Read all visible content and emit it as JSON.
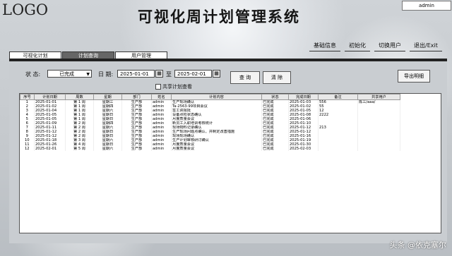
{
  "app": {
    "logo": "LOGO",
    "title": "可视化周计划管理系统",
    "user": "admin"
  },
  "topmenu": [
    "基础信息",
    "初始化",
    "切换用户",
    "退出/Exit"
  ],
  "tabs": [
    {
      "label": "可视化计划",
      "active": false
    },
    {
      "label": "计划查询",
      "active": true
    },
    {
      "label": "用户管理",
      "active": false
    }
  ],
  "filters": {
    "status_label": "状 态:",
    "status_value": "已完成",
    "date_label": "日 期:",
    "date_from": "2025-01-01",
    "to_label": "至",
    "date_to": "2025-02-01",
    "query_button": "查 询",
    "clear_button": "清 除",
    "export_button": "导出明细",
    "shared_checkbox": "共享计划查看"
  },
  "table": {
    "columns": [
      "序号",
      "计划日期",
      "周数",
      "星期",
      "部门",
      "姓名",
      "计划内容",
      "状态",
      "完成日期",
      "备注",
      "共享用户"
    ],
    "rows": [
      [
        "1",
        "2025-01-01",
        "第 1 周",
        "星期三",
        "生产部",
        "admin",
        "生产现场确认",
        "已完成",
        "2025-01-03",
        "556",
        "陈三/aaa/"
      ],
      [
        "2",
        "2025-01-02",
        "第 1 周",
        "星期四",
        "生产部",
        "admin",
        "Ta-2563-99项目会议",
        "已完成",
        "2025-01-02",
        "55",
        ""
      ],
      [
        "3",
        "2025-01-04",
        "第 1 周",
        "星期六",
        "生产部",
        "admin",
        "签工资报批",
        "已完成",
        "2025-01-05",
        "12",
        ""
      ],
      [
        "4",
        "2025-01-05",
        "第 1 周",
        "星期日",
        "生产部",
        "admin",
        "设备点检状态确认",
        "已完成",
        "2025-01-08",
        "2222",
        ""
      ],
      [
        "5",
        "2025-01-05",
        "第 1 周",
        "星期日",
        "生产部",
        "admin",
        "月度质量会议",
        "已完成",
        "2025-01-06",
        "",
        ""
      ],
      [
        "6",
        "2025-01-09",
        "第 2 周",
        "星期四",
        "生产部",
        "admin",
        "新员工入职培训考核统计",
        "已完成",
        "2025-01-10",
        "",
        ""
      ],
      [
        "7",
        "2025-01-11",
        "第 2 周",
        "星期六",
        "生产部",
        "admin",
        "现场物料记录确认",
        "已完成",
        "2025-01-12",
        "213",
        ""
      ],
      [
        "8",
        "2025-01-12",
        "第 2 周",
        "星期日",
        "生产部",
        "admin",
        "生产现场问题点确认、并制定改善措施",
        "已完成",
        "2025-01-12",
        "",
        ""
      ],
      [
        "9",
        "2025-01-12",
        "第 2 周",
        "星期日",
        "生产部",
        "admin",
        "现场现场确认",
        "已完成",
        "2025-01-16",
        "",
        ""
      ],
      [
        "10",
        "2025-01-18",
        "第 3 周",
        "星期六",
        "生产部",
        "admin",
        "生产计划审核研讨确认",
        "已完成",
        "2025-01-19",
        "",
        ""
      ],
      [
        "11",
        "2025-01-26",
        "第 4 周",
        "星期日",
        "生产部",
        "admin",
        "月度质量会议",
        "已完成",
        "2025-01-30",
        "",
        ""
      ],
      [
        "12",
        "2025-02-01",
        "第 5 周",
        "星期六",
        "生产部",
        "admin",
        "月度质量会议",
        "已完成",
        "2025-02-03",
        "",
        ""
      ]
    ]
  },
  "watermark": "头条 @依克塞尔"
}
